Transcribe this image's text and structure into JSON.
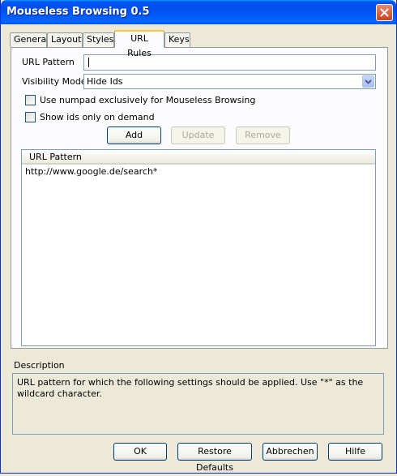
{
  "window": {
    "title": "Mouseless Browsing 0.5"
  },
  "tabs": [
    "General",
    "Layout",
    "Styles",
    "URL Rules",
    "Keys"
  ],
  "active_tab": "URL Rules",
  "form": {
    "url_pattern_label": "URL Pattern",
    "url_pattern_value": "",
    "visibility_label": "Visibility Mode",
    "visibility_value": "Hide Ids",
    "numpad_checkbox_label": "Use numpad exclusively for Mouseless Browsing",
    "numpad_checked": false,
    "ondemand_checkbox_label": "Show ids only on demand",
    "ondemand_checked": false
  },
  "actions": {
    "add": "Add",
    "update": "Update",
    "remove": "Remove"
  },
  "list": {
    "column_header": "URL Pattern",
    "rows": [
      "http://www.google.de/search*"
    ]
  },
  "description": {
    "label": "Description",
    "text": "URL pattern for which the following settings should be applied. Use \"*\" as the wildcard character."
  },
  "footer": {
    "ok": "OK",
    "restore": "Restore Defaults",
    "cancel": "Abbrechen",
    "help": "Hilfe"
  },
  "colors": {
    "title_blue": "#0053ee",
    "close_red": "#c8431e",
    "tab_highlight": "#ffc83c"
  },
  "icons": {
    "close": "close-icon",
    "dropdown": "chevron-down-icon"
  }
}
